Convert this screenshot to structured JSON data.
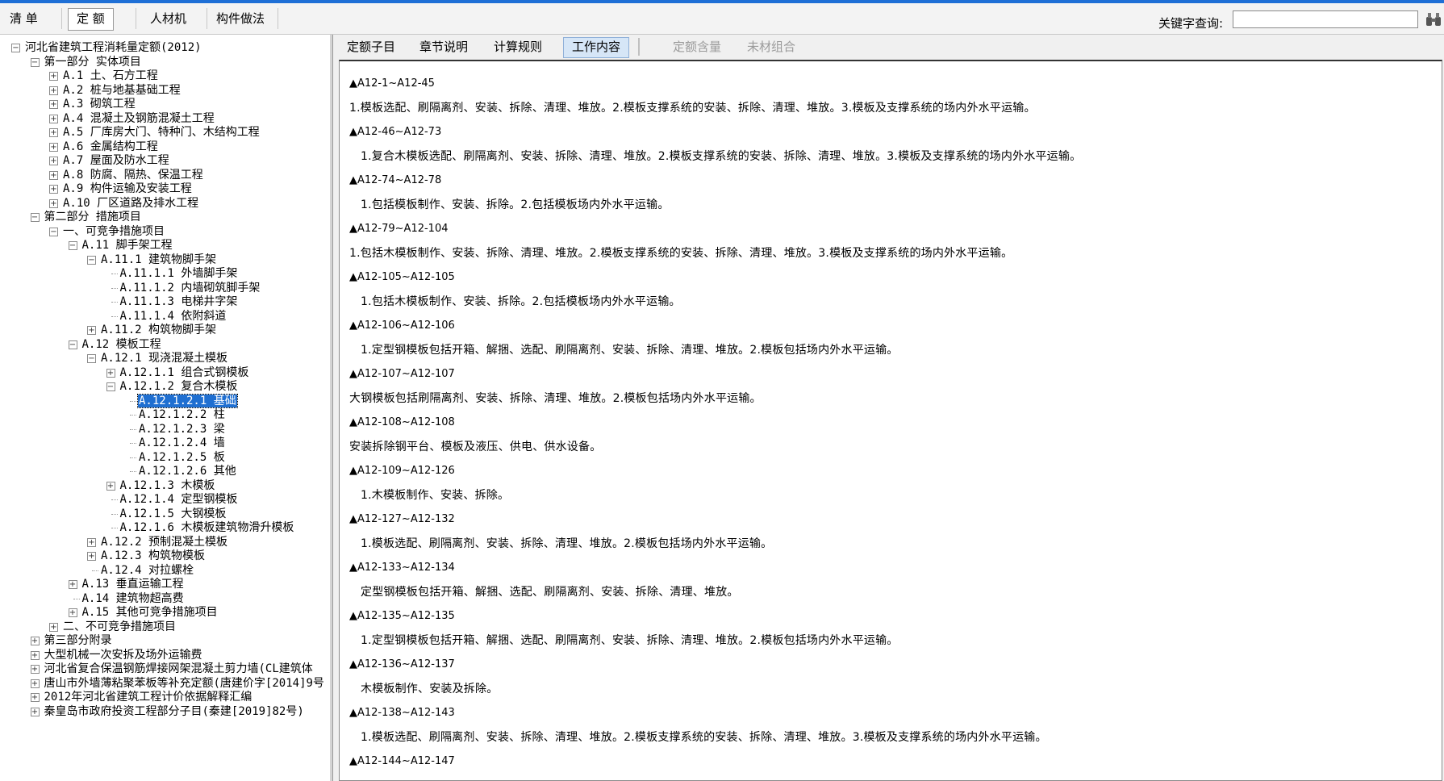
{
  "toolbar": {
    "buttons": [
      "清 单",
      "定 额",
      "人材机",
      "构件做法"
    ],
    "active": "定 额",
    "keyword_label": "关键字查询:",
    "keyword_value": ""
  },
  "tree": {
    "rows": [
      {
        "text": "河北省建筑工程消耗量定额(2012)",
        "level": 0,
        "toggle": "-"
      },
      {
        "text": "第一部分 实体项目",
        "level": 1,
        "toggle": "-"
      },
      {
        "text": "A.1 土、石方工程",
        "level": 2,
        "toggle": "+"
      },
      {
        "text": "A.2 桩与地基基础工程",
        "level": 2,
        "toggle": "+"
      },
      {
        "text": "A.3 砌筑工程",
        "level": 2,
        "toggle": "+"
      },
      {
        "text": "A.4 混凝土及钢筋混凝土工程",
        "level": 2,
        "toggle": "+"
      },
      {
        "text": "A.5 厂库房大门、特种门、木结构工程",
        "level": 2,
        "toggle": "+"
      },
      {
        "text": "A.6 金属结构工程",
        "level": 2,
        "toggle": "+"
      },
      {
        "text": "A.7 屋面及防水工程",
        "level": 2,
        "toggle": "+"
      },
      {
        "text": "A.8 防腐、隔热、保温工程",
        "level": 2,
        "toggle": "+"
      },
      {
        "text": "A.9 构件运输及安装工程",
        "level": 2,
        "toggle": "+"
      },
      {
        "text": "A.10 厂区道路及排水工程",
        "level": 2,
        "toggle": "+"
      },
      {
        "text": "第二部分 措施项目",
        "level": 1,
        "toggle": "-"
      },
      {
        "text": "一、可竞争措施项目",
        "level": 2,
        "toggle": "-"
      },
      {
        "text": "A.11 脚手架工程",
        "level": 3,
        "toggle": "-"
      },
      {
        "text": "A.11.1 建筑物脚手架",
        "level": 4,
        "toggle": "-"
      },
      {
        "text": "A.11.1.1 外墙脚手架",
        "level": 5,
        "toggle": ""
      },
      {
        "text": "A.11.1.2 内墙砌筑脚手架",
        "level": 5,
        "toggle": ""
      },
      {
        "text": "A.11.1.3 电梯井字架",
        "level": 5,
        "toggle": ""
      },
      {
        "text": "A.11.1.4 依附斜道",
        "level": 5,
        "toggle": ""
      },
      {
        "text": "A.11.2 构筑物脚手架",
        "level": 4,
        "toggle": "+"
      },
      {
        "text": "A.12 模板工程",
        "level": 3,
        "toggle": "-"
      },
      {
        "text": "A.12.1 现浇混凝土模板",
        "level": 4,
        "toggle": "-"
      },
      {
        "text": "A.12.1.1 组合式钢模板",
        "level": 5,
        "toggle": "+"
      },
      {
        "text": "A.12.1.2 复合木模板",
        "level": 5,
        "toggle": "-"
      },
      {
        "text": "A.12.1.2.1 基础",
        "level": 6,
        "toggle": "",
        "selected": true
      },
      {
        "text": "A.12.1.2.2 柱",
        "level": 6,
        "toggle": ""
      },
      {
        "text": "A.12.1.2.3 梁",
        "level": 6,
        "toggle": ""
      },
      {
        "text": "A.12.1.2.4 墙",
        "level": 6,
        "toggle": ""
      },
      {
        "text": "A.12.1.2.5 板",
        "level": 6,
        "toggle": ""
      },
      {
        "text": "A.12.1.2.6 其他",
        "level": 6,
        "toggle": ""
      },
      {
        "text": "A.12.1.3 木模板",
        "level": 5,
        "toggle": "+"
      },
      {
        "text": "A.12.1.4 定型钢模板",
        "level": 5,
        "toggle": ""
      },
      {
        "text": "A.12.1.5 大钢模板",
        "level": 5,
        "toggle": ""
      },
      {
        "text": "A.12.1.6 木模板建筑物滑升模板",
        "level": 5,
        "toggle": ""
      },
      {
        "text": "A.12.2 预制混凝土模板",
        "level": 4,
        "toggle": "+"
      },
      {
        "text": "A.12.3 构筑物模板",
        "level": 4,
        "toggle": "+"
      },
      {
        "text": "A.12.4 对拉螺栓",
        "level": 4,
        "toggle": ""
      },
      {
        "text": "A.13 垂直运输工程",
        "level": 3,
        "toggle": "+"
      },
      {
        "text": "A.14 建筑物超高费",
        "level": 3,
        "toggle": ""
      },
      {
        "text": "A.15 其他可竞争措施项目",
        "level": 3,
        "toggle": "+"
      },
      {
        "text": "二、不可竞争措施项目",
        "level": 2,
        "toggle": "+"
      },
      {
        "text": "第三部分附录",
        "level": 1,
        "toggle": "+"
      },
      {
        "text": "大型机械一次安拆及场外运输费",
        "level": 1,
        "toggle": "+"
      },
      {
        "text": "河北省复合保温钢筋焊接网架混凝土剪力墙(CL建筑体",
        "level": 1,
        "toggle": "+"
      },
      {
        "text": "唐山市外墙薄粘聚苯板等补充定额(唐建价字[2014]9号",
        "level": 1,
        "toggle": "+"
      },
      {
        "text": "2012年河北省建筑工程计价依据解释汇编",
        "level": 1,
        "toggle": "+"
      },
      {
        "text": "秦皇岛市政府投资工程部分子目(秦建[2019]82号)",
        "level": 1,
        "toggle": "+"
      }
    ]
  },
  "tabs": [
    {
      "label": "定额子目",
      "state": "normal"
    },
    {
      "label": "章节说明",
      "state": "normal"
    },
    {
      "label": "计算规则",
      "state": "normal"
    },
    {
      "label": "工作内容",
      "state": "active"
    },
    {
      "label": "定额含量",
      "state": "disabled"
    },
    {
      "label": "未材组合",
      "state": "disabled"
    }
  ],
  "content": {
    "lines": [
      {
        "type": "hdr",
        "text": "▲A12-1~A12-45",
        "indent": 0
      },
      {
        "type": "desc",
        "text": "1.模板选配、刷隔离剂、安装、拆除、清理、堆放。2.模板支撑系统的安装、拆除、清理、堆放。3.模板及支撑系统的场内外水平运输。",
        "indent": 0
      },
      {
        "type": "hdr",
        "text": "▲A12-46~A12-73",
        "indent": 0
      },
      {
        "type": "desc",
        "text": "1.复合木模板选配、刷隔离剂、安装、拆除、清理、堆放。2.模板支撑系统的安装、拆除、清理、堆放。3.模板及支撑系统的场内外水平运输。",
        "indent": 1
      },
      {
        "type": "hdr",
        "text": "▲A12-74~A12-78",
        "indent": 0
      },
      {
        "type": "desc",
        "text": "1.包括模板制作、安装、拆除。2.包括模板场内外水平运输。",
        "indent": 1
      },
      {
        "type": "hdr",
        "text": "▲A12-79~A12-104",
        "indent": 0
      },
      {
        "type": "desc",
        "text": "1.包括木模板制作、安装、拆除、清理、堆放。2.模板支撑系统的安装、拆除、清理、堆放。3.模板及支撑系统的场内外水平运输。",
        "indent": 0
      },
      {
        "type": "hdr",
        "text": "▲A12-105~A12-105",
        "indent": 0
      },
      {
        "type": "desc",
        "text": "1.包括木模板制作、安装、拆除。2.包括模板场内外水平运输。",
        "indent": 1
      },
      {
        "type": "hdr",
        "text": "▲A12-106~A12-106",
        "indent": 0
      },
      {
        "type": "desc",
        "text": "1.定型钢模板包括开箱、解捆、选配、刷隔离剂、安装、拆除、清理、堆放。2.模板包括场内外水平运输。",
        "indent": 1
      },
      {
        "type": "hdr",
        "text": "▲A12-107~A12-107",
        "indent": 0
      },
      {
        "type": "desc",
        "text": "大钢模板包括刷隔离剂、安装、拆除、清理、堆放。2.模板包括场内外水平运输。",
        "indent": 0
      },
      {
        "type": "hdr",
        "text": "▲A12-108~A12-108",
        "indent": 0
      },
      {
        "type": "desc",
        "text": "安装拆除钢平台、模板及液压、供电、供水设备。",
        "indent": 0
      },
      {
        "type": "hdr",
        "text": "▲A12-109~A12-126",
        "indent": 0
      },
      {
        "type": "desc",
        "text": "1.木模板制作、安装、拆除。",
        "indent": 1
      },
      {
        "type": "hdr",
        "text": "▲A12-127~A12-132",
        "indent": 0
      },
      {
        "type": "desc",
        "text": "1.模板选配、刷隔离剂、安装、拆除、清理、堆放。2.模板包括场内外水平运输。",
        "indent": 1
      },
      {
        "type": "hdr",
        "text": "▲A12-133~A12-134",
        "indent": 0
      },
      {
        "type": "desc",
        "text": "定型钢模板包括开箱、解捆、选配、刷隔离剂、安装、拆除、清理、堆放。",
        "indent": 1
      },
      {
        "type": "hdr",
        "text": "▲A12-135~A12-135",
        "indent": 0
      },
      {
        "type": "desc",
        "text": "1.定型钢模板包括开箱、解捆、选配、刷隔离剂、安装、拆除、清理、堆放。2.模板包括场内外水平运输。",
        "indent": 1
      },
      {
        "type": "hdr",
        "text": "▲A12-136~A12-137",
        "indent": 0
      },
      {
        "type": "desc",
        "text": "木模板制作、安装及拆除。",
        "indent": 1
      },
      {
        "type": "hdr",
        "text": "▲A12-138~A12-143",
        "indent": 0
      },
      {
        "type": "desc",
        "text": "1.模板选配、刷隔离剂、安装、拆除、清理、堆放。2.模板支撑系统的安装、拆除、清理、堆放。3.模板及支撑系统的场内外水平运输。",
        "indent": 1
      },
      {
        "type": "hdr",
        "text": "▲A12-144~A12-147",
        "indent": 0
      }
    ]
  }
}
